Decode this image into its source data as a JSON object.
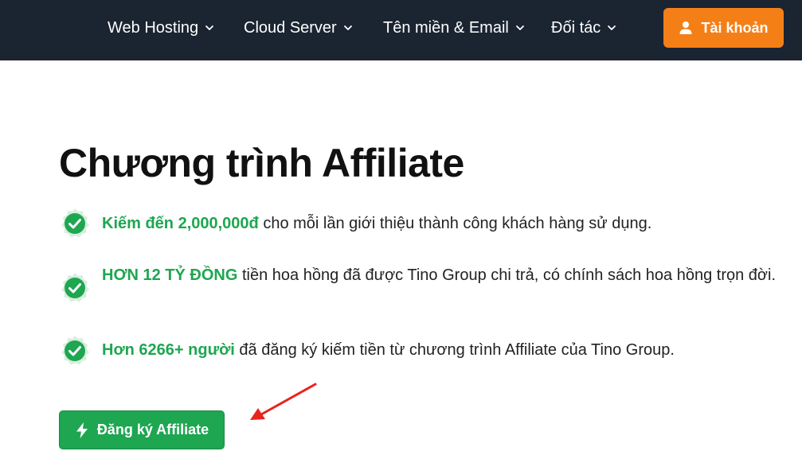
{
  "nav": {
    "items": [
      {
        "label": "Web Hosting"
      },
      {
        "label": "Cloud Server"
      },
      {
        "label": "Tên miền & Email"
      },
      {
        "label": "Đối tác"
      }
    ],
    "account_label": "Tài khoản"
  },
  "main": {
    "title": "Chương trình Affiliate",
    "features": [
      {
        "highlight": "Kiếm đến 2,000,000đ",
        "text": " cho mỗi lần giới thiệu thành công khách hàng sử dụng."
      },
      {
        "highlight": "HƠN 12 TỶ ĐỒNG",
        "text": " tiền hoa hồng đã được Tino Group chi trả, có chính sách hoa hồng trọn đời."
      },
      {
        "highlight": "Hơn 6266+ người",
        "text": " đã đăng ký kiếm tiền từ chương trình Affiliate của Tino Group."
      }
    ],
    "cta_label": "Đăng ký Affiliate"
  },
  "colors": {
    "nav_bg": "#1b2431",
    "accent_orange": "#f57f17",
    "accent_green": "#1ea651",
    "arrow_red": "#e8231e"
  },
  "icons": {
    "account": "user-icon",
    "cta": "lightning-bolt-icon",
    "feature": "check-badge-icon",
    "nav": "chevron-down-icon"
  }
}
